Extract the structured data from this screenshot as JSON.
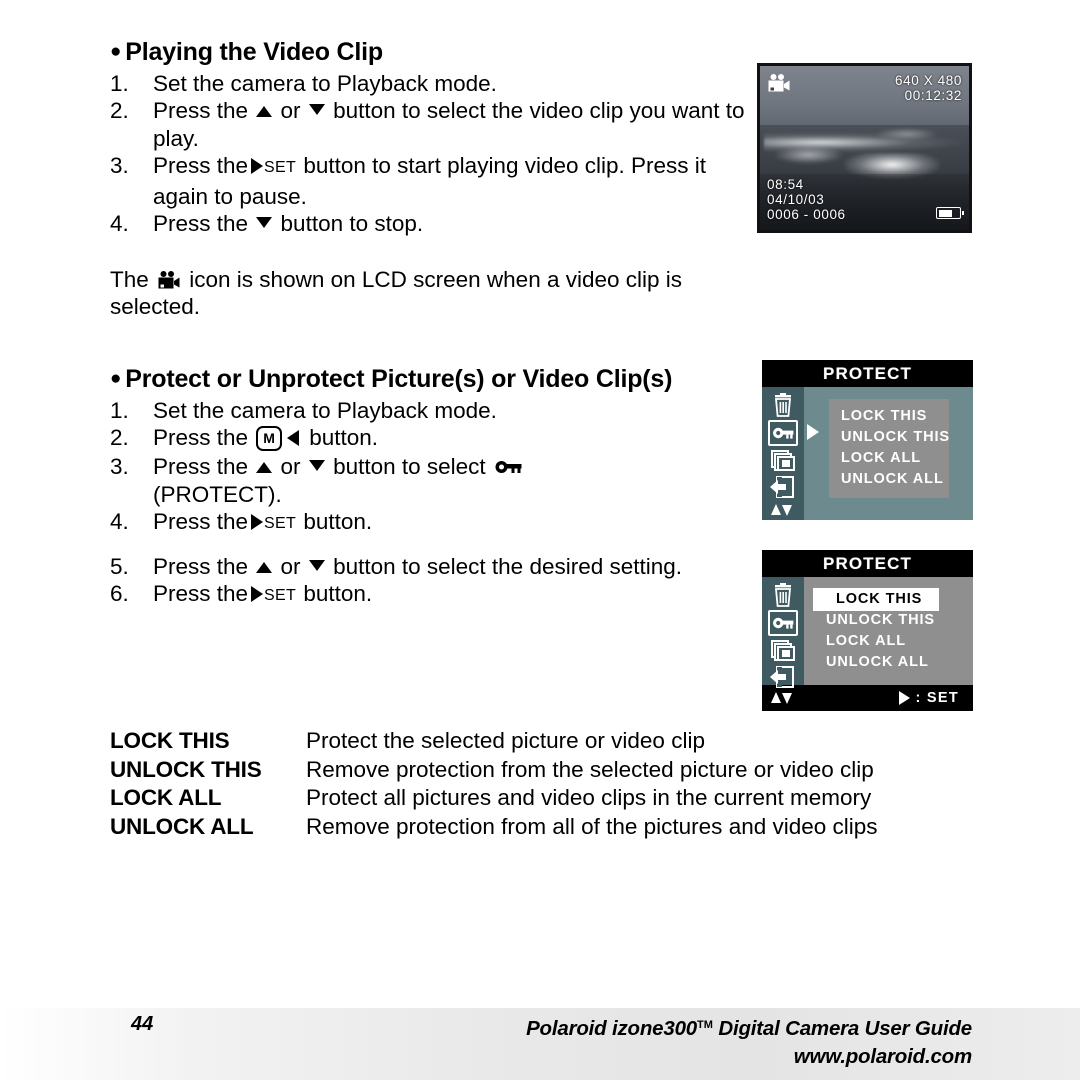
{
  "section1": {
    "heading": "Playing the Video Clip",
    "steps": [
      {
        "num": "1.",
        "parts": [
          {
            "t": "text",
            "v": "Set the camera to Playback mode."
          }
        ]
      },
      {
        "num": "2.",
        "parts": [
          {
            "t": "text",
            "v": "Press the "
          },
          {
            "t": "icon",
            "v": "triangle-up-icon"
          },
          {
            "t": "text",
            "v": " or "
          },
          {
            "t": "icon",
            "v": "triangle-down-icon"
          },
          {
            "t": "text",
            "v": " button to select the video clip you want to play."
          }
        ]
      },
      {
        "num": "3.",
        "parts": [
          {
            "t": "text",
            "v": "Press the"
          },
          {
            "t": "icon",
            "v": "triangle-right-icon"
          },
          {
            "t": "label",
            "v": "SET"
          },
          {
            "t": "text",
            "v": " button to start playing video clip. Press it again to pause."
          }
        ]
      },
      {
        "num": "4.",
        "parts": [
          {
            "t": "text",
            "v": "Press the "
          },
          {
            "t": "icon",
            "v": "triangle-down-icon"
          },
          {
            "t": "text",
            "v": " button to stop."
          }
        ]
      }
    ],
    "note_before": "The ",
    "note_icon": "video-camera-icon",
    "note_after": " icon is shown on LCD screen when a video clip is selected."
  },
  "section2": {
    "heading": "Protect or Unprotect Picture(s) or Video Clip(s)",
    "steps_a": [
      {
        "num": "1.",
        "text": "Set the camera to Playback mode."
      },
      {
        "num": "2.",
        "text": "Press the [M] ◀ button."
      },
      {
        "num": "3.",
        "text": "Press the ▲ or ▼ button to select 🔑 (PROTECT)."
      },
      {
        "num": "4.",
        "text": "Press the ▶ SET button."
      }
    ],
    "steps_b": [
      {
        "num": "5.",
        "text": "Press the ▲ or ▼ button to select the desired setting."
      },
      {
        "num": "6.",
        "text": "Press the ▶ SET button."
      }
    ],
    "step1_text": "Set the camera to Playback mode.",
    "step2_pre": "Press the ",
    "step2_m": "M",
    "step2_post": " button.",
    "step3_pre": "Press the ",
    "step3_mid": " or ",
    "step3_post": " button to select ",
    "step3_paren": "(PROTECT).",
    "step4_pre": "Press the",
    "step4_set": "SET",
    "step4_post": " button.",
    "step5_pre": "Press the ",
    "step5_mid": " or ",
    "step5_post": " button to select the desired setting.",
    "step6_pre": "Press the",
    "step6_set": "SET",
    "step6_post": " button.",
    "num1": "1.",
    "num2": "2.",
    "num3": "3.",
    "num4": "4.",
    "num5": "5.",
    "num6": "6."
  },
  "definitions": [
    {
      "term": "LOCK THIS",
      "desc": "Protect the selected picture or video clip",
      "justify": false
    },
    {
      "term": "UNLOCK THIS",
      "desc": "Remove protection from the selected picture or video clip",
      "justify": true
    },
    {
      "term": "LOCK ALL",
      "desc": "Protect all pictures and video clips in the current memory",
      "justify": true
    },
    {
      "term": "UNLOCK ALL",
      "desc": "Remove protection from all of the pictures and video clips",
      "justify": true
    }
  ],
  "lcd_photo": {
    "resolution": "640 X 480",
    "duration": "00:12:32",
    "time": "08:54",
    "date": "04/10/03",
    "counter": "0006 - 0006",
    "video_icon": "video-camera-icon",
    "battery_icon": "battery-icon"
  },
  "menu1": {
    "title": "PROTECT",
    "items": [
      "LOCK THIS",
      "UNLOCK THIS",
      "LOCK ALL",
      "UNLOCK ALL"
    ],
    "selected_index": -1,
    "side_icons": [
      "trash-icon",
      "key-icon",
      "copy-icon",
      "transfer-icon"
    ],
    "side_selected": "key-icon",
    "updown_icon": "up-down-arrows-icon",
    "caret_icon": "caret-right-icon"
  },
  "menu2": {
    "title": "PROTECT",
    "items": [
      "LOCK THIS",
      "UNLOCK THIS",
      "LOCK ALL",
      "UNLOCK ALL"
    ],
    "selected_index": 0,
    "side_icons": [
      "trash-icon",
      "key-icon",
      "copy-icon",
      "transfer-icon"
    ],
    "side_selected": "key-icon",
    "updown_icon": "up-down-arrows-icon",
    "foot_set_label": ": SET"
  },
  "footer": {
    "page_number": "44",
    "guide_title_a": "Polaroid izone300",
    "guide_tm": "TM",
    "guide_title_b": "Digital Camera User Guide",
    "website": "www.polaroid.com"
  },
  "colors": {
    "menu_bg": "#6d8b8f",
    "menu_sidebar": "#3f5a60",
    "menu_list_bg": "#8f8f8f",
    "menu_title_bg": "#000000",
    "highlight_bg": "#ffffff"
  }
}
